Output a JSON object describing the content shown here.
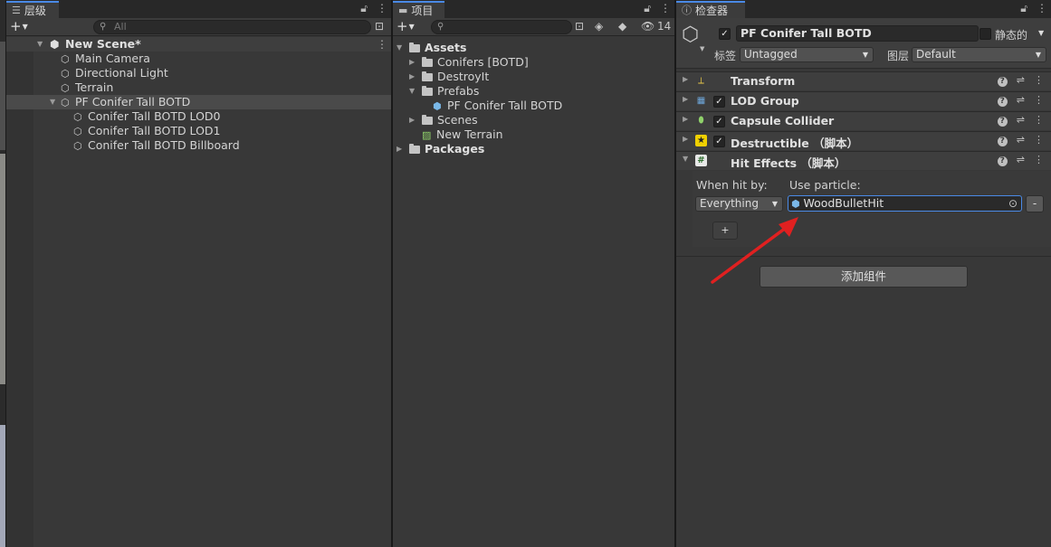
{
  "hierarchy": {
    "tab_label": "层级",
    "search_placeholder": "All",
    "scene_name": "New Scene*",
    "items": [
      {
        "label": "Main Camera"
      },
      {
        "label": "Directional Light"
      },
      {
        "label": "Terrain"
      },
      {
        "label": "PF Conifer Tall BOTD"
      },
      {
        "label": "Conifer Tall BOTD LOD0"
      },
      {
        "label": "Conifer Tall BOTD LOD1"
      },
      {
        "label": "Conifer Tall BOTD Billboard"
      }
    ]
  },
  "project": {
    "tab_label": "项目",
    "hidden_count": "14",
    "tree": [
      {
        "label": "Assets"
      },
      {
        "label": "Conifers [BOTD]"
      },
      {
        "label": "DestroyIt"
      },
      {
        "label": "Prefabs"
      },
      {
        "label": "PF Conifer Tall BOTD"
      },
      {
        "label": "Scenes"
      },
      {
        "label": "New Terrain"
      },
      {
        "label": "Packages"
      }
    ]
  },
  "inspector": {
    "tab_label": "检查器",
    "object_name": "PF Conifer Tall BOTD",
    "static_label": "静态的",
    "tag_label": "标签",
    "tag_value": "Untagged",
    "layer_label": "图层",
    "layer_value": "Default",
    "components": [
      {
        "title": "Transform",
        "has_checkbox": false,
        "checked": false,
        "icon": "transform-icon",
        "icon_color": "#e8c84a"
      },
      {
        "title": "LOD Group",
        "has_checkbox": true,
        "checked": true,
        "icon": "lod-group-icon",
        "icon_color": "#6fa8dc"
      },
      {
        "title": "Capsule Collider",
        "has_checkbox": true,
        "checked": true,
        "icon": "capsule-collider-icon",
        "icon_color": "#8fd16a"
      },
      {
        "title": "Destructible （脚本）",
        "has_checkbox": true,
        "checked": true,
        "icon": "script-icon",
        "icon_color": "#f0d000"
      },
      {
        "title": "Hit Effects （脚本）",
        "has_checkbox": false,
        "checked": false,
        "icon": "script-icon",
        "icon_color": "#bde0b0"
      }
    ],
    "hit_effects": {
      "when_hit_by_label": "When hit by:",
      "use_particle_label": "Use particle:",
      "when_hit_by_value": "Everything",
      "particle_value": "WoodBulletHit",
      "remove_label": "-",
      "add_label": "+"
    },
    "add_component_label": "添加组件"
  },
  "colors": {
    "accent": "#4a8ae6",
    "annotation_arrow": "#e02020",
    "selected_row": "#4a4a4a"
  }
}
